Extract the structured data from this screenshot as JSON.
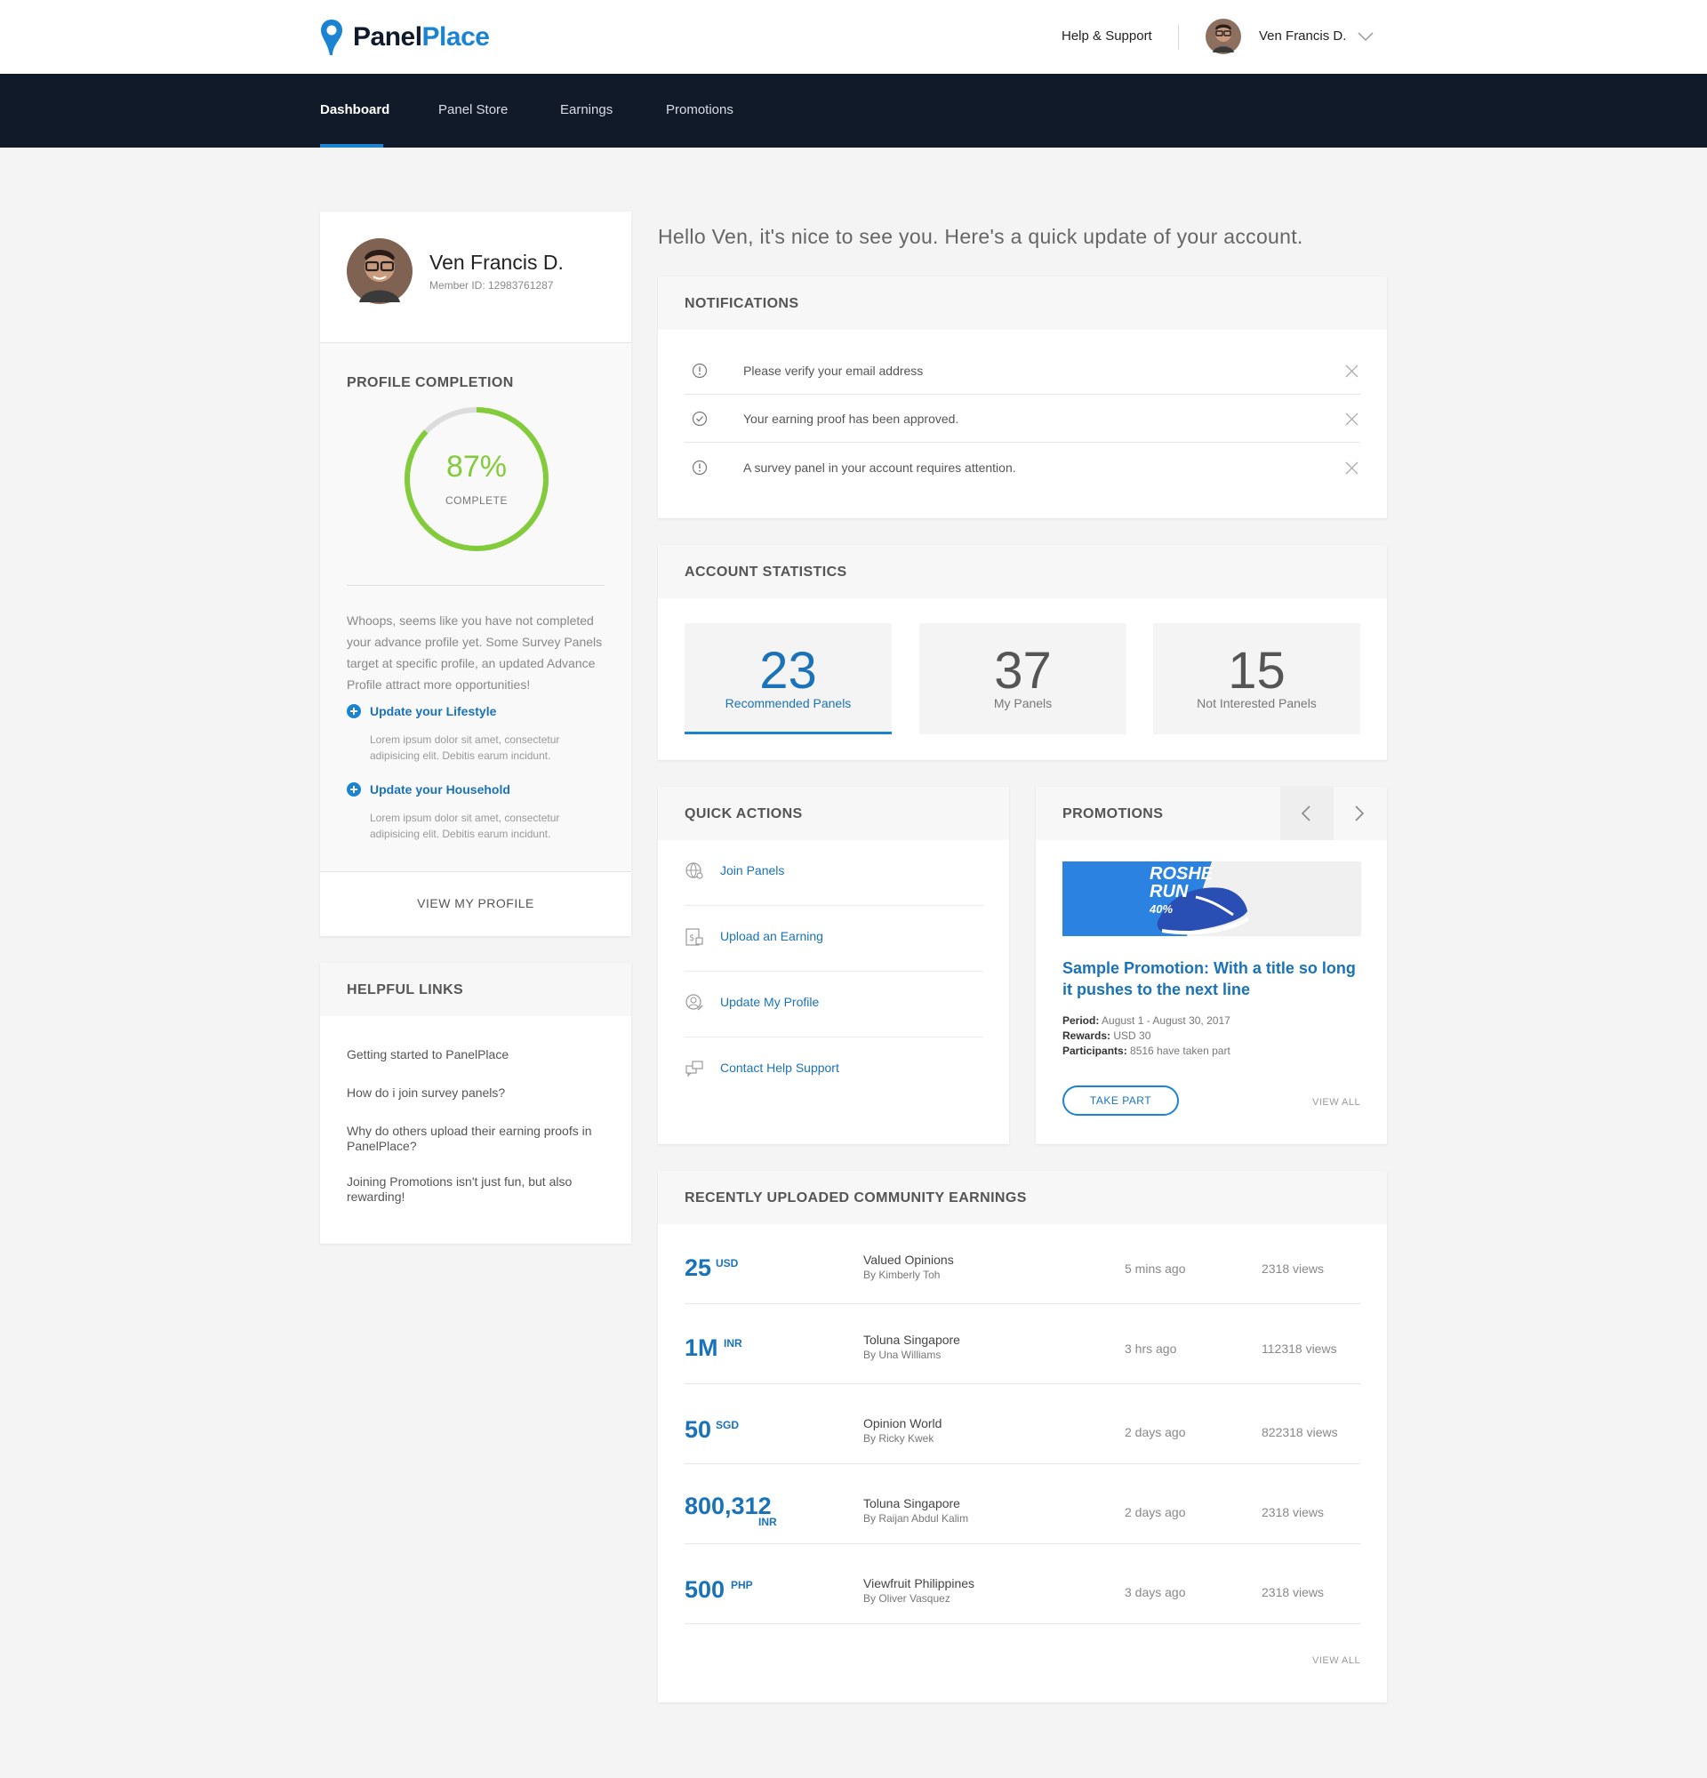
{
  "brand": {
    "logo_part1": "Panel",
    "logo_part2": "Place",
    "accent_color": "#1a84d3",
    "nav_bg": "#101a29"
  },
  "header": {
    "help_label": "Help & Support",
    "user_name": "Ven Francis D.",
    "dropdown_icon": "chevron-down-icon"
  },
  "nav": {
    "items": [
      {
        "label": "Dashboard",
        "active": true
      },
      {
        "label": "Panel Store"
      },
      {
        "label": "Earnings"
      },
      {
        "label": "Promotions"
      }
    ]
  },
  "profile": {
    "name": "Ven Francis D.",
    "member_id": "Member ID: 12983761287"
  },
  "profile_completion": {
    "title": "PROFILE COMPLETION",
    "percent": 87,
    "percent_label": "87%",
    "complete_label": "COMPLETE",
    "ring_color": "#82cc3c",
    "message": "Whoops, seems like you have not completed your advance profile yet. Some Survey Panels target at specific profile, an updated Advance Profile attract more opportunities!",
    "links": [
      {
        "label": "Update your Lifestyle",
        "desc": "Lorem ipsum dolor sit amet, consectetur adipisicing elit. Debitis earum incidunt."
      },
      {
        "label": "Update your Household",
        "desc": "Lorem ipsum dolor sit amet, consectetur adipisicing elit. Debitis earum incidunt."
      }
    ],
    "view_profile_label": "VIEW MY PROFILE"
  },
  "helpful_links": {
    "title": "HELPFUL LINKS",
    "items": [
      "Getting started to PanelPlace",
      "How do i join survey panels?",
      "Why do others upload their earning proofs in PanelPlace?",
      "Joining Promotions isn't just fun, but also rewarding!"
    ]
  },
  "greeting": "Hello Ven, it's nice to see you. Here's a quick update of your account.",
  "notifications": {
    "title": "NOTIFICATIONS",
    "items": [
      {
        "icon": "alert-circle-icon",
        "text": "Please verify your email address"
      },
      {
        "icon": "check-circle-icon",
        "text": "Your earning proof has been approved."
      },
      {
        "icon": "alert-circle-icon",
        "text": "A survey panel in your account requires attention."
      }
    ]
  },
  "account_statistics": {
    "title": "ACCOUNT STATISTICS",
    "stats": [
      {
        "value": "23",
        "label": "Recommended Panels",
        "active": true
      },
      {
        "value": "37",
        "label": "My Panels"
      },
      {
        "value": "15",
        "label": "Not Interested Panels"
      }
    ]
  },
  "quick_actions": {
    "title": "QUICK ACTIONS",
    "items": [
      {
        "icon": "globe-user-icon",
        "label": "Join Panels"
      },
      {
        "icon": "upload-money-icon",
        "label": "Upload an Earning"
      },
      {
        "icon": "profile-edit-icon",
        "label": "Update My Profile"
      },
      {
        "icon": "chat-bubbles-icon",
        "label": "Contact Help Support"
      }
    ]
  },
  "promotions": {
    "title": "PROMOTIONS",
    "banner_line1": "ROSHE",
    "banner_line2": "RUN",
    "banner_line3": "40%",
    "promo_title": "Sample Promotion: With a title so long it pushes to the next line",
    "period_label": "Period:",
    "period_value": "August 1 - August 30, 2017",
    "rewards_label": "Rewards:",
    "rewards_value": "USD 30",
    "participants_label": "Participants:",
    "participants_value": "8516 have taken part",
    "take_part_label": "TAKE PART",
    "view_all_label": "VIEW ALL"
  },
  "earnings": {
    "title": "RECENTLY UPLOADED COMMUNITY EARNINGS",
    "rows": [
      {
        "amount": "25",
        "currency": "USD",
        "source": "Valued Opinions",
        "by": "By Kimberly Toh",
        "time": "5 mins ago",
        "views": "2318 views"
      },
      {
        "amount": "1M",
        "currency": "INR",
        "source": "Toluna Singapore",
        "by": "By Una Williams",
        "time": "3 hrs ago",
        "views": "112318 views"
      },
      {
        "amount": "50",
        "currency": "SGD",
        "source": "Opinion World",
        "by": "By Ricky Kwek",
        "time": "2 days ago",
        "views": "822318 views"
      },
      {
        "amount": "800,312",
        "currency": "INR",
        "source": "Toluna Singapore",
        "by": "By Raijan Abdul Kalim",
        "time": "2 days ago",
        "views": "2318 views"
      },
      {
        "amount": "500",
        "currency": "PHP",
        "source": "Viewfruit Philippines",
        "by": "By Oliver Vasquez",
        "time": "3 days ago",
        "views": "2318 views"
      }
    ],
    "view_all_label": "VIEW ALL"
  }
}
